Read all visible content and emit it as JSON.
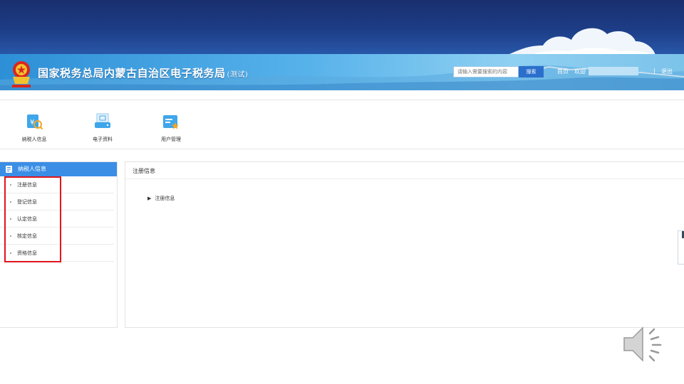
{
  "header": {
    "title": "国家税务总局内蒙古自治区电子税务局",
    "title_tag": "(测试)",
    "search_placeholder": "请输入需要搜索的内容",
    "search_button": "搜索",
    "home_link": "首页",
    "welcome": "欢迎",
    "separator": "|",
    "logout": "退出"
  },
  "modules": [
    {
      "label": "纳税人信息",
      "icon": "taxpayer-info-icon"
    },
    {
      "label": "电子资料",
      "icon": "electronic-documents-icon"
    },
    {
      "label": "用户管理",
      "icon": "user-management-icon"
    }
  ],
  "sidebar": {
    "title": "纳税人信息",
    "items": [
      {
        "label": "注册信息"
      },
      {
        "label": "登记信息"
      },
      {
        "label": "认定信息"
      },
      {
        "label": "核定信息"
      },
      {
        "label": "资格信息"
      }
    ]
  },
  "main": {
    "title": "注册信息",
    "tree_node": "注册信息"
  },
  "colors": {
    "top_band": "#1d3d86",
    "header_blue": "#57b2ea",
    "accent": "#3a8ee6",
    "highlight": "#e0161d"
  }
}
